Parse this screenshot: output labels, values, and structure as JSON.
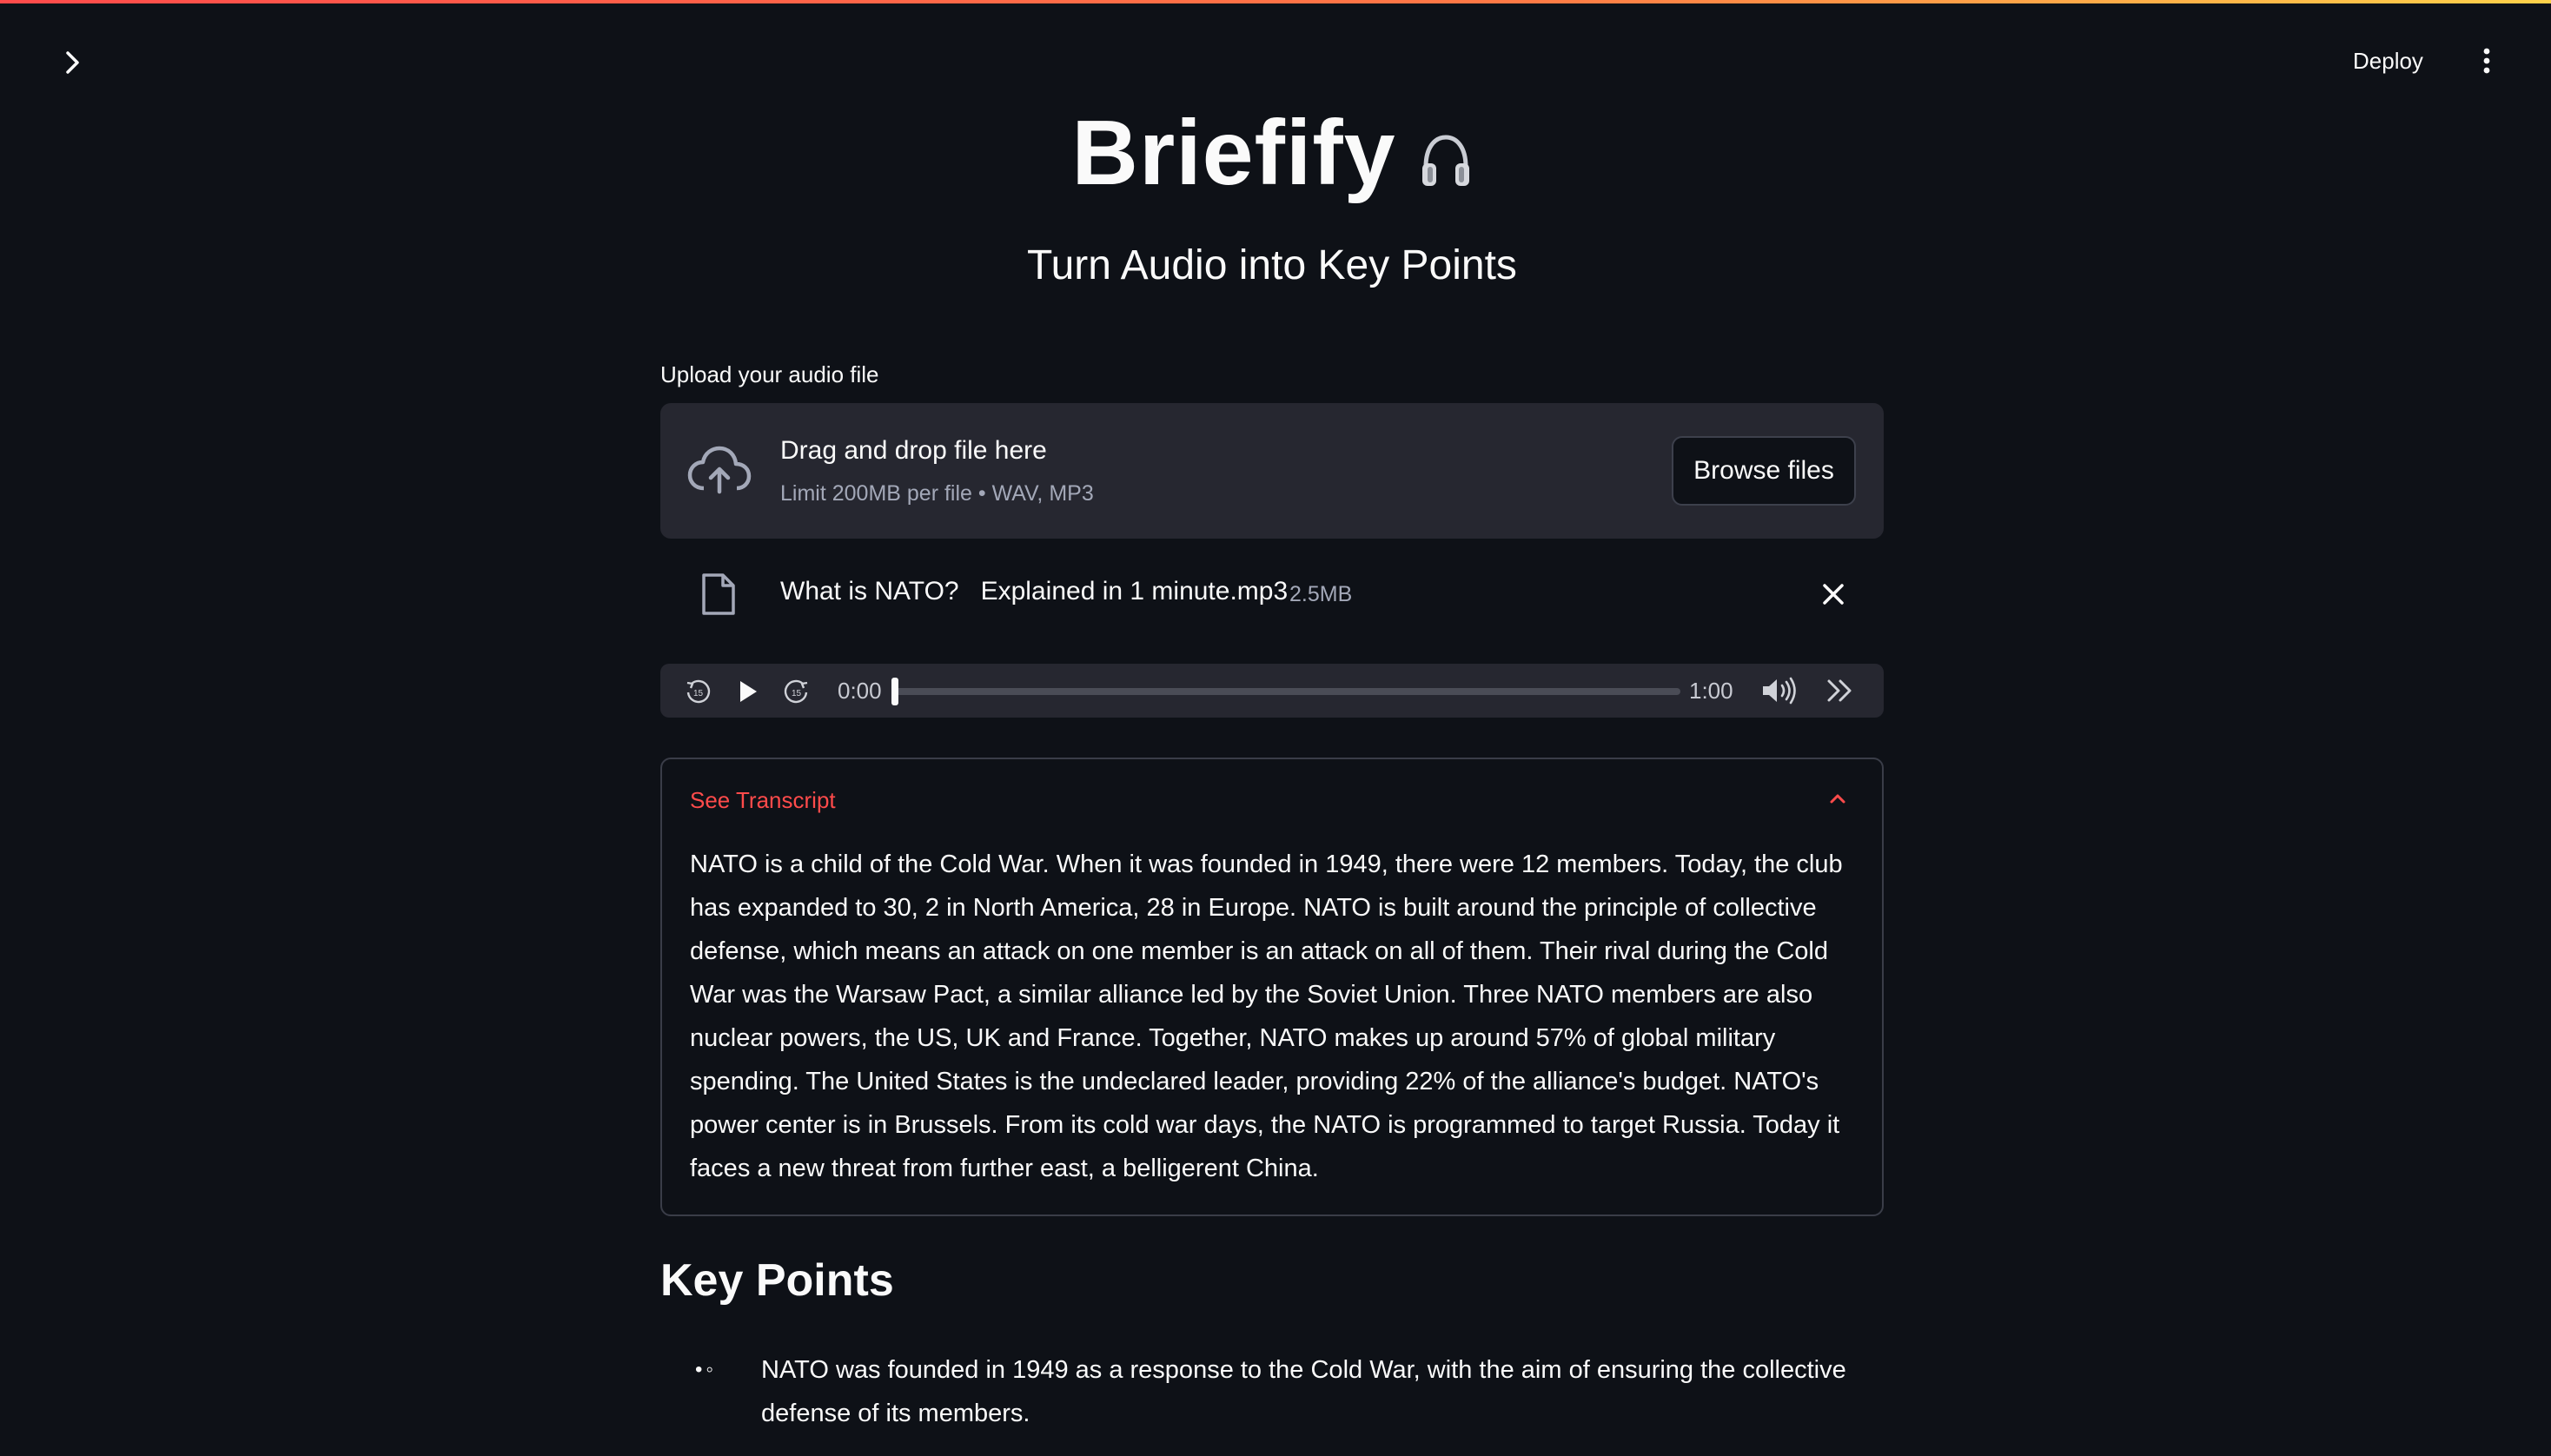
{
  "app": {
    "title": "Briefify",
    "title_icon": "headphones-icon",
    "subtitle": "Turn Audio into Key Points",
    "accent_color": "#ff4b4b"
  },
  "header": {
    "deploy_label": "Deploy",
    "menu_icon": "kebab-menu-icon",
    "sidebar_toggle_icon": "chevron-right-icon"
  },
  "uploader": {
    "label": "Upload your audio file",
    "drop_title": "Drag and drop file here",
    "drop_limit": "Limit 200MB per file • WAV, MP3",
    "browse_label": "Browse files",
    "file": {
      "name": "What is NATO?   Explained in 1 minute.mp3",
      "size": "2.5MB"
    }
  },
  "player": {
    "current_time": "0:00",
    "duration": "1:00",
    "progress_fraction": 0.0
  },
  "transcript": {
    "toggle_label": "See Transcript",
    "expanded": true,
    "text": "NATO is a child of the Cold War. When it was founded in 1949, there were 12 members. Today, the club has expanded to 30, 2 in North America, 28 in Europe. NATO is built around the principle of collective defense, which means an attack on one member is an attack on all of them. Their rival during the Cold War was the Warsaw Pact, a similar alliance led by the Soviet Union. Three NATO members are also nuclear powers, the US, UK and France. Together, NATO makes up around 57% of global military spending. The United States is the undeclared leader, providing 22% of the alliance's budget. NATO's power center is in Brussels. From its cold war days, the NATO is programmed to target Russia. Today it faces a new threat from further east, a belligerent China."
  },
  "key_points": {
    "heading": "Key Points",
    "bullet_marker": "•◦",
    "items": [
      "NATO was founded in 1949 as a response to the Cold War, with the aim of ensuring the collective defense of its members."
    ]
  }
}
